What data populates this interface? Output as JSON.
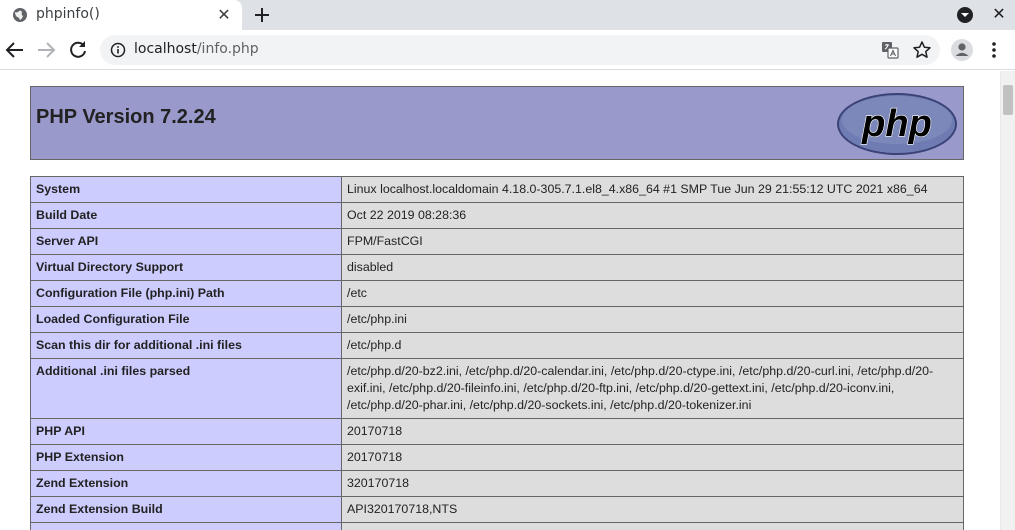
{
  "browser": {
    "tab_title": "phpinfo()",
    "tab_close": "✕",
    "window_close": "✕",
    "url_host": "localhost",
    "url_path": "/info.php"
  },
  "php": {
    "title": "PHP Version 7.2.24",
    "logo_text": "php",
    "rows": [
      {
        "key": "System",
        "value": "Linux localhost.localdomain 4.18.0-305.7.1.el8_4.x86_64 #1 SMP Tue Jun 29 21:55:12 UTC 2021 x86_64"
      },
      {
        "key": "Build Date",
        "value": "Oct 22 2019 08:28:36"
      },
      {
        "key": "Server API",
        "value": "FPM/FastCGI"
      },
      {
        "key": "Virtual Directory Support",
        "value": "disabled"
      },
      {
        "key": "Configuration File (php.ini) Path",
        "value": "/etc"
      },
      {
        "key": "Loaded Configuration File",
        "value": "/etc/php.ini"
      },
      {
        "key": "Scan this dir for additional .ini files",
        "value": "/etc/php.d"
      },
      {
        "key": "Additional .ini files parsed",
        "value": "/etc/php.d/20-bz2.ini, /etc/php.d/20-calendar.ini, /etc/php.d/20-ctype.ini, /etc/php.d/20-curl.ini, /etc/php.d/20-exif.ini, /etc/php.d/20-fileinfo.ini, /etc/php.d/20-ftp.ini, /etc/php.d/20-gettext.ini, /etc/php.d/20-iconv.ini, /etc/php.d/20-phar.ini, /etc/php.d/20-sockets.ini, /etc/php.d/20-tokenizer.ini"
      },
      {
        "key": "PHP API",
        "value": "20170718"
      },
      {
        "key": "PHP Extension",
        "value": "20170718"
      },
      {
        "key": "Zend Extension",
        "value": "320170718"
      },
      {
        "key": "Zend Extension Build",
        "value": "API320170718,NTS"
      },
      {
        "key": "",
        "value": ""
      }
    ]
  },
  "colors": {
    "header_bg": "#9999cc",
    "key_cell_bg": "#ccccff",
    "value_cell_bg": "#dddddd",
    "logo_fill": "#6f7cb4"
  }
}
